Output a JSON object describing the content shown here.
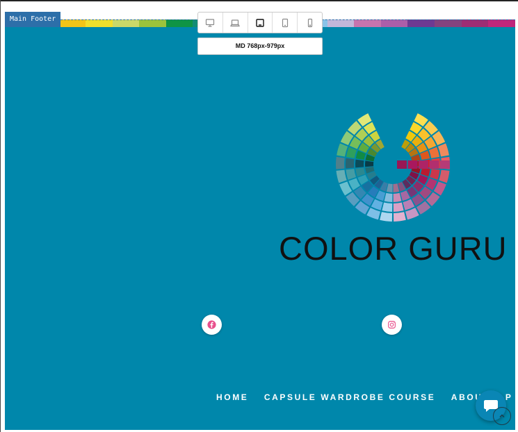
{
  "editor": {
    "section_tag": "Main Footer",
    "breakpoint_label": "MD  768px-979px",
    "devices": [
      {
        "name": "desktop",
        "active": false
      },
      {
        "name": "laptop",
        "active": false
      },
      {
        "name": "tablet-landscape",
        "active": true
      },
      {
        "name": "tablet-portrait",
        "active": false
      },
      {
        "name": "mobile",
        "active": false
      }
    ]
  },
  "footer": {
    "background_color": "#0087ab",
    "rainbow_colors": [
      "#e5732a",
      "#eba21e",
      "#f2c418",
      "#f1df2c",
      "#c9d869",
      "#9bc33c",
      "#0f9446",
      "#138c75",
      "#0f7d8d",
      "#0c6e9f",
      "#1d7ac5",
      "#8ac3e8",
      "#c2b7da",
      "#c774ae",
      "#ac5ea9",
      "#6e3a92",
      "#84437f",
      "#9d2d74",
      "#c0267b"
    ],
    "logo": {
      "text": "COLOR GURU",
      "wheel_colors": [
        "#fcd20d",
        "#f7b80f",
        "#f39a16",
        "#e95c1e",
        "#e32126",
        "#c41c32",
        "#a9185e",
        "#94306f",
        "#7b3a7d",
        "#b06dab",
        "#d792bd",
        "#8dc7ea",
        "#4ca6de",
        "#2882c5",
        "#1877a8",
        "#31a7bd",
        "#2c8f98",
        "#0c4f5e",
        "#129247",
        "#63b543",
        "#a4c93f",
        "#d6df42"
      ]
    },
    "social": [
      {
        "icon": "facebook-icon",
        "color": "#e8508c"
      },
      {
        "icon": "instagram-icon",
        "color": "#e8508c"
      }
    ],
    "nav": [
      "HOME",
      "CAPSULE WARDROBE COURSE",
      "ABOUT",
      "P"
    ]
  }
}
